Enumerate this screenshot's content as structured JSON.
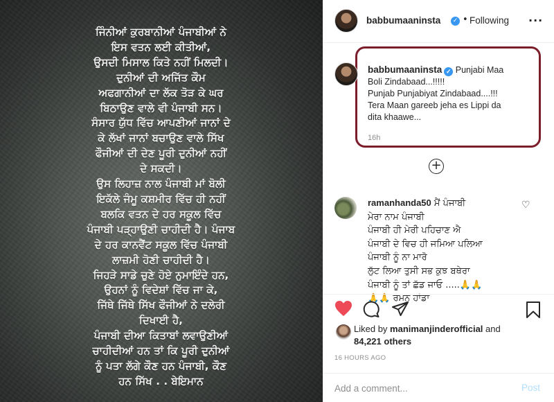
{
  "post_image": {
    "poem_lines": [
      "ਜਿੰਨੀਆਂ ਕੁਰਬਾਨੀਆਂ ਪੰਜਾਬੀਆਂ ਨੇ",
      "ਇਸ ਵਤਨ ਲਈ ਕੀਤੀਆਂ,",
      "ਉਸਦੀ ਮਿਸਾਲ ਕਿਤੇ ਨਹੀਂ ਮਿਲਦੀ।",
      "ਦੁਨੀਆਂ ਦੀ ਅਜਿੱਤ ਕੌਮ",
      "ਅਫਗਾਨੀਆਂ ਦਾ ਲੱਕ ਤੋੜ ਕੇ ਘਰ",
      "ਬਿਠਾਉਣ ਵਾਲੇ ਵੀ ਪੰਜਾਬੀ ਸਨ।",
      "ਸੰਸਾਰ ਯੁੱਧ ਵਿੱਚ ਆਪਣੀਆਂ ਜਾਨਾਂ ਦੇ",
      "ਕੇ ਲੱਖਾਂ ਜਾਨਾਂ ਬਚਾਉਣ ਵਾਲੇ ਸਿੱਖ",
      "ਫੌਜੀਆਂ ਦੀ ਦੇਣ ਪੂਰੀ ਦੁਨੀਆਂ ਨਹੀਂ",
      "ਦੇ ਸਕਦੀ।",
      "ਉਸ ਲਿਹਾਜ਼ ਨਾਲ ਪੰਜਾਬੀ ਮਾਂ ਬੋਲੀ",
      "ਇਕੱਲੇ ਜੰਮੂ ਕਸ਼ਮੀਰ ਵਿੱਚ ਹੀ ਨਹੀਂ",
      "ਬਲਕਿ ਵਤਨ ਦੇ ਹਰ ਸਕੂਲ ਵਿੱਚ",
      "ਪੰਜਾਬੀ ਪੜ੍ਹਾਉਣੀ ਚਾਹੀਦੀ ਹੈ। ਪੰਜਾਬ",
      "ਦੇ ਹਰ ਕਾਨਵੈਂਟ ਸਕੂਲ ਵਿੱਚ ਪੰਜਾਬੀ",
      "ਲਾਜ਼ਮੀ ਹੋਣੀ ਚਾਹੀਦੀ ਹੈ।",
      "ਜਿਹੜੇ ਸਾਡੇ ਚੁਣੇ ਹੋਏ ਨੁਮਾਇੰਦੇ ਹਨ,",
      "ਉਹਨਾਂ ਨੂੰ ਵਿਦੇਸ਼ਾਂ ਵਿੱਚ ਜਾ ਕੇ,",
      "ਜਿੱਥੇ ਜਿੱਥੇ ਸਿੱਖ ਫੌਜੀਆਂ ਨੇ ਦਲੇਰੀ",
      "ਦਿਖਾਈ ਹੈ,",
      "ਪੰਜਾਬੀ ਦੀਆ ਕਿਤਾਬਾਂ ਲਵਾਉਣੀਆਂ",
      "ਚਾਹੀਦੀਆਂ ਹਨ ਤਾਂ ਕਿ ਪੂਰੀ ਦੁਨੀਆਂ",
      "ਨੂੰ ਪਤਾ ਲੱਗੇ ਕੌਣ ਹਨ ਪੰਜਾਬੀ, ਕੌਣ",
      "ਹਨ ਸਿੱਖ . . ਬੇਇਮਾਨ"
    ]
  },
  "header": {
    "username": "babbumaaninsta",
    "verified_badge": "✓",
    "separator": "•",
    "follow_status": "Following",
    "more_options": "···"
  },
  "caption": {
    "username": "babbumaaninsta",
    "verified_badge": "✓",
    "lines": [
      "Punjabi Maa",
      "Boli Zindabaad...!!!!!",
      "Punjab Punjabiyat Zindabaad....!!!",
      "Tera Maan gareeb jeha es Lippi da",
      "dita khaawe..."
    ],
    "time": "16h",
    "highlight_color": "#7d1c2a"
  },
  "load_more": {
    "icon": "+"
  },
  "comment": {
    "username": "ramanhanda50",
    "first_line": "ਮੈਂ ਪੰਜਾਬੀ",
    "lines": [
      "ਮੇਰਾ ਨਾਮ ਪੰਜਾਬੀ",
      "ਪੰਜਾਬੀ ਹੀ ਮੇਰੀ ਪਹਿਚਾਣ ਐ",
      "ਪੰਜਾਬੀ ਦੇ ਵਿਚ ਹੀ ਜਮਿਆ ਪਲਿਆ",
      "ਪੰਜਾਬੀ ਨੂੰ ਨਾ ਮਾਰੋ",
      "ਲੁੱਟ ਲਿਆ ਤੁਸੀ ਸਭ ਕੁਝ ਬਥੇਰਾ",
      "ਪੰਜਾਬੀ ਨੂੰ ਤਾਂ ਛੱਡ ਜਾਓ .....🙏🙏",
      "🙏🙏 ਰਮਨ ਹਾਂਡਾ"
    ],
    "like_icon": "♡"
  },
  "actions": {
    "like_icon": "heart-filled",
    "like_color": "#ed4956",
    "comment_icon": "comment-bubble",
    "share_icon": "paper-plane",
    "save_icon": "bookmark"
  },
  "likes": {
    "prefix": "Liked by",
    "user": "manimanjinderofficial",
    "conj": "and",
    "count": "84,221 others"
  },
  "timestamp": "16 HOURS AGO",
  "add_comment": {
    "placeholder": "Add a comment...",
    "post_label": "Post"
  }
}
